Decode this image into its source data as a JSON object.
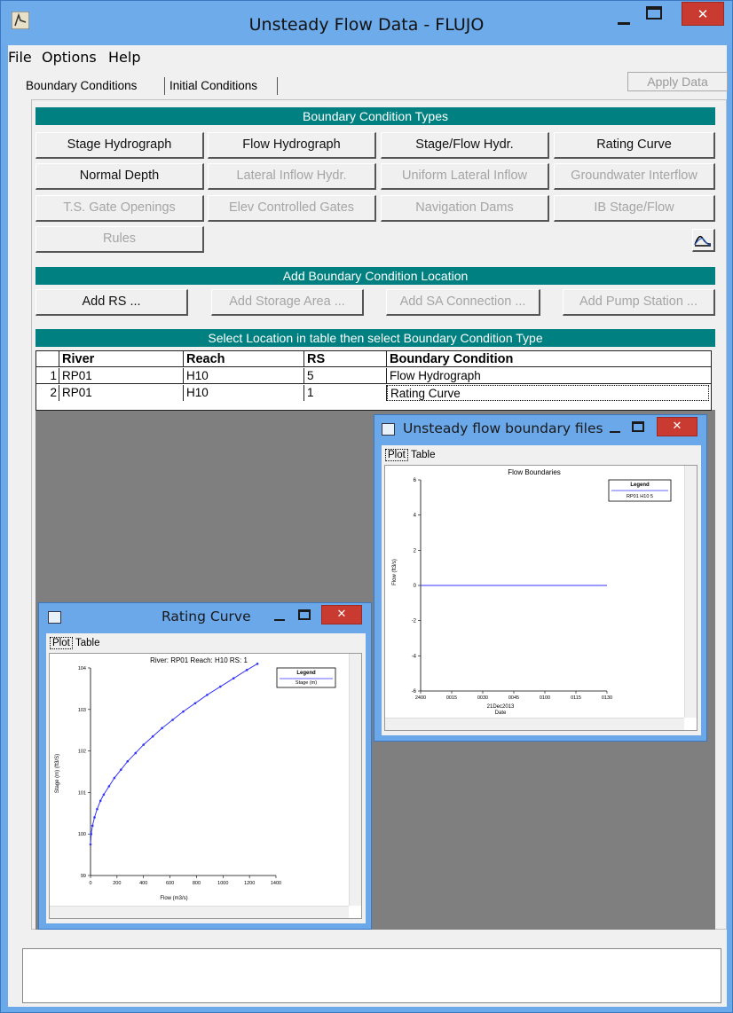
{
  "window": {
    "title": "Unsteady Flow Data - FLUJO",
    "close_glyph": "✕"
  },
  "menu": [
    "File",
    "Options",
    "Help"
  ],
  "tabs": {
    "boundary": "Boundary Conditions",
    "initial": "Initial Conditions",
    "apply": "Apply Data"
  },
  "bc_types": {
    "header": "Boundary Condition Types",
    "buttons": [
      {
        "label": "Stage Hydrograph",
        "enabled": true
      },
      {
        "label": "Flow Hydrograph",
        "enabled": true
      },
      {
        "label": "Stage/Flow Hydr.",
        "enabled": true
      },
      {
        "label": "Rating Curve",
        "enabled": true
      },
      {
        "label": "Normal Depth",
        "enabled": true
      },
      {
        "label": "Lateral Inflow Hydr.",
        "enabled": false
      },
      {
        "label": "Uniform Lateral Inflow",
        "enabled": false
      },
      {
        "label": "Groundwater Interflow",
        "enabled": false
      },
      {
        "label": "T.S. Gate Openings",
        "enabled": false
      },
      {
        "label": "Elev Controlled Gates",
        "enabled": false
      },
      {
        "label": "Navigation Dams",
        "enabled": false
      },
      {
        "label": "IB Stage/Flow",
        "enabled": false
      },
      {
        "label": "Rules",
        "enabled": false
      }
    ]
  },
  "add_location": {
    "header": "Add Boundary Condition Location",
    "buttons": [
      {
        "label": "Add RS ...",
        "enabled": true
      },
      {
        "label": "Add Storage Area ...",
        "enabled": false
      },
      {
        "label": "Add SA Connection ...",
        "enabled": false
      },
      {
        "label": "Add Pump Station ...",
        "enabled": false
      }
    ]
  },
  "table": {
    "header": "Select Location in table then select Boundary Condition Type",
    "columns": [
      "River",
      "Reach",
      "RS",
      "Boundary Condition"
    ],
    "rows": [
      [
        "1",
        "RP01",
        "H10",
        "5",
        "Flow Hydrograph"
      ],
      [
        "2",
        "RP01",
        "H10",
        "1",
        "Rating Curve"
      ]
    ]
  },
  "flow_window": {
    "title": "Unsteady flow boundary files",
    "tabs": [
      "Plot",
      "Table"
    ],
    "chart_data": {
      "type": "line",
      "title": "Flow Boundaries",
      "xlabel": "Date",
      "ylabel": "Flow (ft3/s)",
      "x_ticks": [
        "2400",
        "0015",
        "0030",
        "0045",
        "0100",
        "0115",
        "0130"
      ],
      "x_date_label": "21Dec2013",
      "y_ticks": [
        "6",
        "4",
        "2",
        "0",
        "-2",
        "-4",
        "-6"
      ],
      "ylim": [
        -6,
        6
      ],
      "legend_title": "Legend",
      "series": [
        {
          "name": "RP01 H10 5",
          "color": "#3333ff",
          "x": [
            "2400",
            "0130"
          ],
          "y": [
            0,
            0
          ]
        }
      ]
    }
  },
  "rating_window": {
    "title": "Rating Curve",
    "tabs": [
      "Plot",
      "Table"
    ],
    "chart_data": {
      "type": "line",
      "title": "River: RP01  Reach: H10  RS: 1",
      "xlabel": "Flow (m3/s)",
      "ylabel": "Stage (m)  (ft3/S)",
      "xlim": [
        0,
        1400
      ],
      "ylim": [
        99,
        104
      ],
      "x_ticks": [
        "0",
        "200",
        "400",
        "600",
        "800",
        "1000",
        "1200",
        "1400"
      ],
      "y_ticks": [
        "104",
        "103",
        "102",
        "101",
        "100",
        "99"
      ],
      "legend_title": "Legend",
      "series": [
        {
          "name": "Stage (m)",
          "color": "#3333ff",
          "x": [
            0,
            5,
            15,
            30,
            50,
            75,
            100,
            140,
            180,
            230,
            280,
            340,
            400,
            470,
            540,
            620,
            700,
            790,
            880,
            980,
            1080,
            1180,
            1260
          ],
          "y": [
            99.75,
            100.0,
            100.2,
            100.4,
            100.6,
            100.8,
            100.95,
            101.15,
            101.35,
            101.55,
            101.75,
            101.95,
            102.15,
            102.35,
            102.55,
            102.75,
            102.95,
            103.15,
            103.35,
            103.55,
            103.75,
            103.95,
            104.1
          ]
        }
      ]
    }
  }
}
